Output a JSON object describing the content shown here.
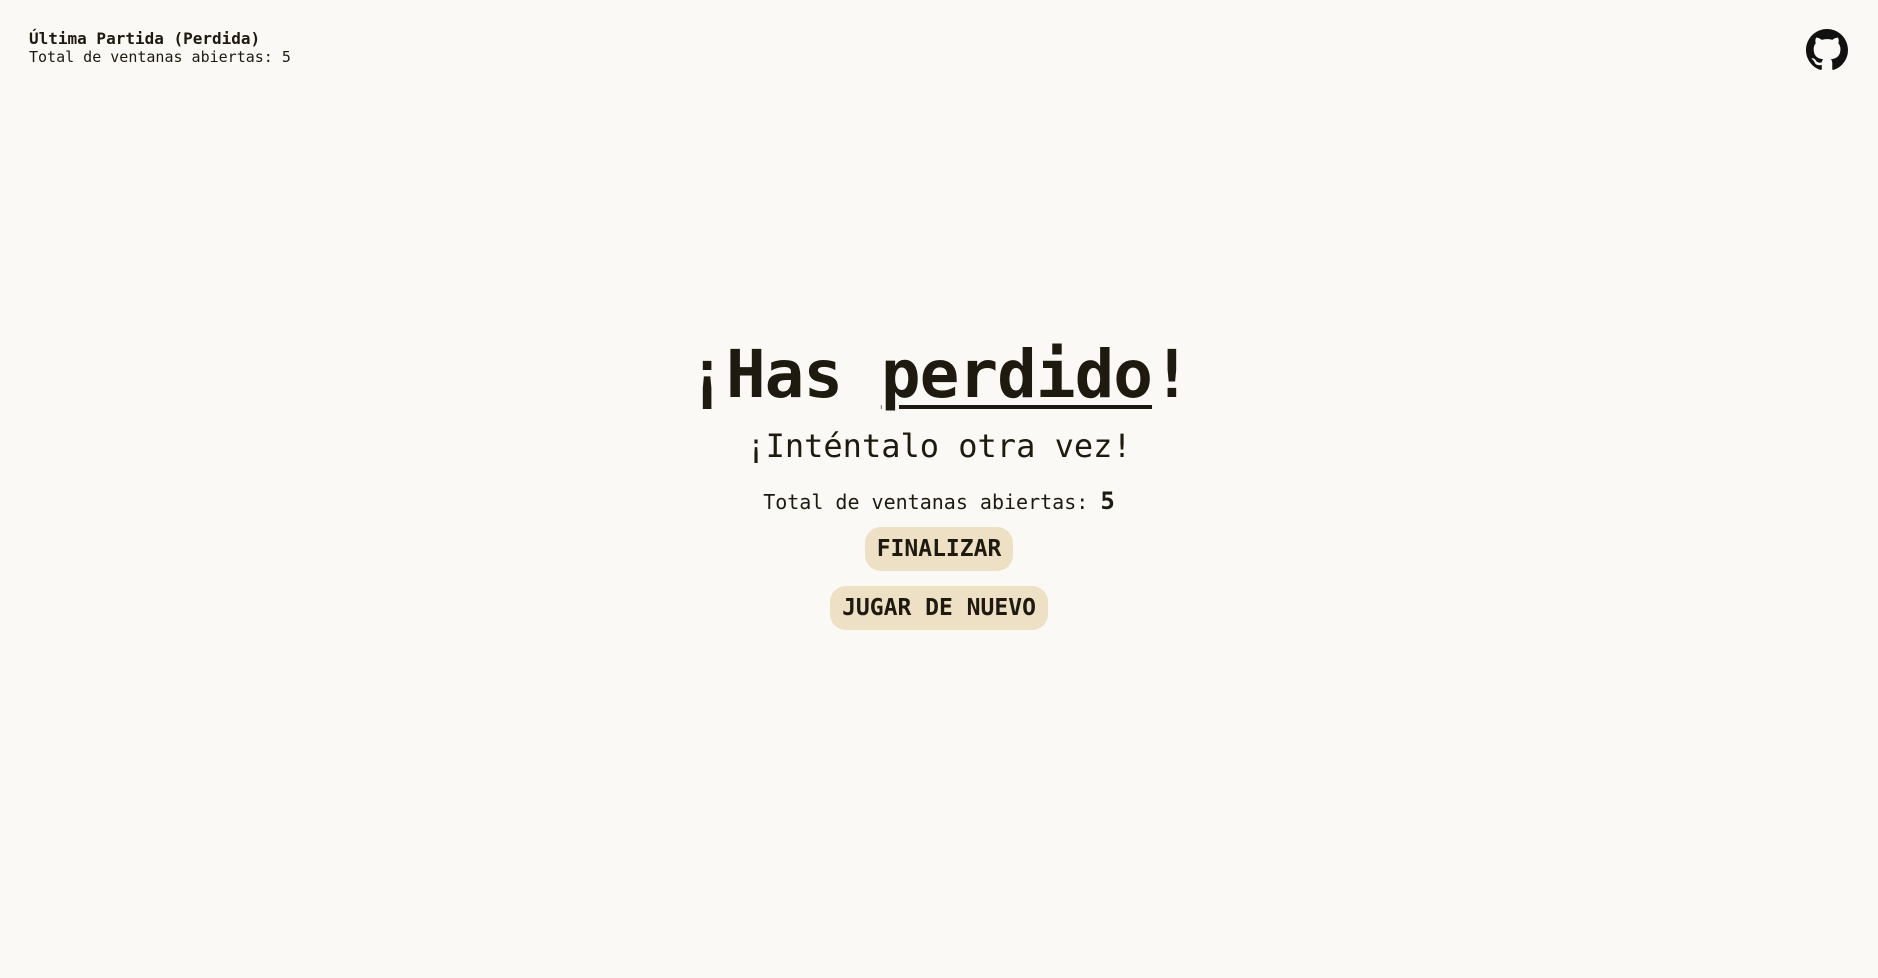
{
  "last_game": {
    "title": "Última Partida (Perdida)",
    "windows_text": "Total de ventanas abiertas: 5"
  },
  "header": {
    "github_icon": "github-icon"
  },
  "result": {
    "headline_prefix": "¡Has ",
    "headline_word": "perdido",
    "headline_suffix": "!",
    "subtitle": "¡Inténtalo otra vez!",
    "windows_label": "Total de ventanas abiertas:",
    "windows_count": "5"
  },
  "actions": {
    "finish_label": "FINALIZAR",
    "play_again_label": "JUGAR DE NUEVO"
  },
  "colors": {
    "background": "#faf9f5",
    "text": "#1f1a10",
    "button_bg": "#ede0c5"
  }
}
